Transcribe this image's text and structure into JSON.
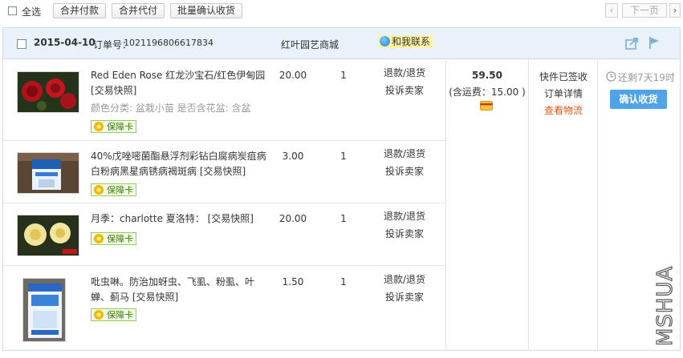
{
  "toolbar": {
    "select_all_label": "全选",
    "merge_pay_label": "合并付款",
    "merge_proxy_pay_label": "合并代付",
    "batch_confirm_label": "批量确认收货",
    "prev_label": "‹",
    "next_label": "下一页",
    "next_arrow": "›"
  },
  "order": {
    "date": "2015-04-10",
    "order_no_label": "订单号：",
    "order_no": "1021196806617834",
    "shop_name": "红叶园艺商城",
    "contact_label": "和我联系",
    "total": "59.50",
    "shipping": "(含运费：15.00 )",
    "status": "快件已签收",
    "detail_link": "订单详情",
    "logistics_link": "查看物流",
    "countdown": "还剩7天19时",
    "confirm_label": "确认收货",
    "items": [
      {
        "name": "Red Eden Rose 红龙沙宝石/红色伊甸园 [交易快照]",
        "attr": "颜色分类: 盆栽小苗  是否含花盆: 含盆",
        "price": "20.00",
        "qty": "1",
        "refund": "退款/退货",
        "complain": "投诉卖家",
        "badge": "保障卡"
      },
      {
        "name": "40%戊唑嘧菌酯悬浮剂彩钻白腐病炭疽病白粉病黑星病锈病褐斑病 [交易快照]",
        "attr": "",
        "price": "3.00",
        "qty": "1",
        "refund": "退款/退货",
        "complain": "投诉卖家",
        "badge": "保障卡"
      },
      {
        "name": "月季：charlotte 夏洛特： [交易快照]",
        "attr": "",
        "price": "20.00",
        "qty": "1",
        "refund": "退款/退货",
        "complain": "投诉卖家",
        "badge": "保障卡"
      },
      {
        "name": "吡虫啉。防治加蚜虫、飞虱、粉虱、叶蝉、蓟马 [交易快照]",
        "attr": "",
        "price": "1.50",
        "qty": "1",
        "refund": "退款/退货",
        "complain": "投诉卖家",
        "badge": "保障卡"
      }
    ]
  },
  "watermark": "MSHUA",
  "colors": {
    "header_bg": "#e9f2fa",
    "border": "#c8dcec",
    "confirm_bg": "#4fa3e6",
    "logistics": "#e8560f",
    "badge_green": "#3a7d00"
  }
}
